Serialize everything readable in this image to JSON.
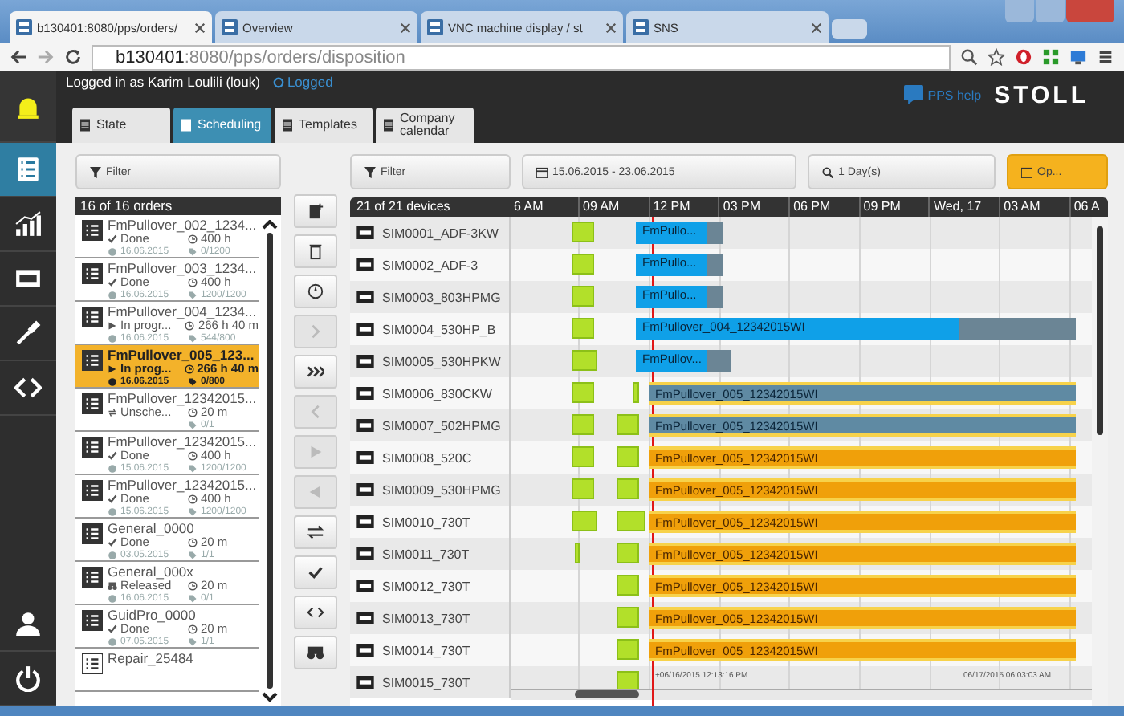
{
  "browser": {
    "tabs": [
      {
        "title": "b130401:8080/pps/orders/",
        "selected": true
      },
      {
        "title": "Overview",
        "selected": false
      },
      {
        "title": "VNC machine display / st",
        "selected": false
      },
      {
        "title": "SNS",
        "selected": false
      }
    ],
    "url_host": "b130401",
    "url_rest": ":8080/pps/orders/disposition"
  },
  "header": {
    "login": "Logged in as Karim Loulili (louk)",
    "logout": "Logged",
    "help": "PPS help",
    "logo": "STOLL"
  },
  "sidebar": {
    "items": [
      {
        "kind": "alarm",
        "selected": false
      },
      {
        "kind": "orders",
        "selected": true
      },
      {
        "kind": "statistics",
        "selected": false
      },
      {
        "kind": "machines",
        "selected": false
      },
      {
        "kind": "service",
        "selected": false
      },
      {
        "kind": "code",
        "selected": false
      }
    ],
    "bottom": [
      {
        "kind": "user"
      },
      {
        "kind": "power"
      }
    ]
  },
  "tabs": [
    {
      "label": "State",
      "selected": false
    },
    {
      "label": "Scheduling",
      "selected": true
    },
    {
      "label": "Templates",
      "selected": false
    },
    {
      "label": "Company calendar",
      "selected": false
    }
  ],
  "orders": {
    "filter": "Filter",
    "count": "16 of 16 orders",
    "items": [
      {
        "name": "FmPullover_002_1234...",
        "kind": "done",
        "status": "Done",
        "time": "400 h",
        "date": "16.06.2015",
        "qty": "0/1200",
        "selected": false
      },
      {
        "name": "FmPullover_003_1234...",
        "kind": "done",
        "status": "Done",
        "time": "400 h",
        "date": "16.06.2015",
        "qty": "1200/1200",
        "selected": false
      },
      {
        "name": "FmPullover_004_1234...",
        "kind": "progress",
        "status": "In progr...",
        "time": "266 h 40 m",
        "date": "16.06.2015",
        "qty": "544/800",
        "selected": false
      },
      {
        "name": "FmPullover_005_123...",
        "kind": "progress",
        "status": "In prog...",
        "time": "266 h 40 m",
        "date": "16.06.2015",
        "qty": "0/800",
        "selected": true
      },
      {
        "name": "FmPullover_12342015...",
        "kind": "unscheduled",
        "status": "Unsche...",
        "time": "20 m",
        "qty": "0/1",
        "selected": false
      },
      {
        "name": "FmPullover_12342015...",
        "kind": "done",
        "status": "Done",
        "time": "400 h",
        "date": "15.06.2015",
        "qty": "1200/1200",
        "selected": false
      },
      {
        "name": "FmPullover_12342015...",
        "kind": "done",
        "status": "Done",
        "time": "400 h",
        "date": "15.06.2015",
        "qty": "1200/1200",
        "selected": false
      },
      {
        "name": "General_0000",
        "kind": "done",
        "status": "Done",
        "time": "20 m",
        "date": "03.05.2015",
        "qty": "1/1",
        "selected": false
      },
      {
        "name": "General_000x",
        "kind": "released",
        "status": "Released",
        "time": "20 m",
        "date": "16.06.2015",
        "qty": "0/1",
        "selected": false
      },
      {
        "name": "GuidPro_0000",
        "kind": "done",
        "status": "Done",
        "time": "20 m",
        "date": "07.05.2015",
        "qty": "1/1",
        "selected": false
      },
      {
        "name": "Repair_25484",
        "kind": "outline",
        "selected": false
      }
    ]
  },
  "toolbar": [
    {
      "kind": "add",
      "disabled": false
    },
    {
      "kind": "delete",
      "disabled": false
    },
    {
      "kind": "compass",
      "disabled": false
    },
    {
      "kind": "next",
      "disabled": true
    },
    {
      "kind": "forward",
      "disabled": false
    },
    {
      "kind": "prev",
      "disabled": true
    },
    {
      "kind": "play",
      "disabled": true
    },
    {
      "kind": "back",
      "disabled": true
    },
    {
      "kind": "swap",
      "disabled": false
    },
    {
      "kind": "check",
      "disabled": false
    },
    {
      "kind": "code",
      "disabled": false
    },
    {
      "kind": "find",
      "disabled": false
    }
  ],
  "gantt": {
    "filter": "Filter",
    "date_range": "15.06.2015 - 23.06.2015",
    "zoom": "1 Day(s)",
    "open": "Op...",
    "count": "21 of 21 devices",
    "time_labels": [
      "6 AM",
      "09 AM",
      "12 PM",
      "03 PM",
      "06 PM",
      "09 PM",
      "Wed, 17",
      "03 AM",
      "06 A"
    ],
    "start_stamp": "+06/16/2015 12:13:16 PM",
    "end_stamp": "06/17/2015 06:03:03 AM",
    "rows": [
      {
        "device": "SIM0001_ADF-3KW",
        "bar": {
          "label": "FmPullo...",
          "kind": "running"
        }
      },
      {
        "device": "SIM0002_ADF-3",
        "bar": {
          "label": "FmPullo...",
          "kind": "running"
        }
      },
      {
        "device": "SIM0003_803HPMG",
        "bar": {
          "label": "FmPullo...",
          "kind": "running"
        }
      },
      {
        "device": "SIM0004_530HP_B",
        "bar": {
          "label": "FmPullover_004_12342015WI",
          "kind": "running"
        }
      },
      {
        "device": "SIM0005_530HPKW",
        "bar": {
          "label": "FmPullov...",
          "kind": "running"
        }
      },
      {
        "device": "SIM0006_830CKW",
        "bar": {
          "label": "FmPullover_005_12342015WI",
          "kind": "queued"
        }
      },
      {
        "device": "SIM0007_502HPMG",
        "bar": {
          "label": "FmPullover_005_12342015WI",
          "kind": "queued"
        }
      },
      {
        "device": "SIM0008_520C",
        "bar": {
          "label": "FmPullover_005_12342015WI",
          "kind": "planned"
        }
      },
      {
        "device": "SIM0009_530HPMG",
        "bar": {
          "label": "FmPullover_005_12342015WI",
          "kind": "planned"
        }
      },
      {
        "device": "SIM0010_730T",
        "bar": {
          "label": "FmPullover_005_12342015WI",
          "kind": "planned"
        }
      },
      {
        "device": "SIM0011_730T",
        "bar": {
          "label": "FmPullover_005_12342015WI",
          "kind": "planned"
        }
      },
      {
        "device": "SIM0012_730T",
        "bar": {
          "label": "FmPullover_005_12342015WI",
          "kind": "planned"
        }
      },
      {
        "device": "SIM0013_730T",
        "bar": {
          "label": "FmPullover_005_12342015WI",
          "kind": "planned"
        }
      },
      {
        "device": "SIM0014_730T",
        "bar": {
          "label": "FmPullover_005_12342015WI",
          "kind": "planned"
        }
      },
      {
        "device": "SIM0015_730T"
      }
    ]
  }
}
